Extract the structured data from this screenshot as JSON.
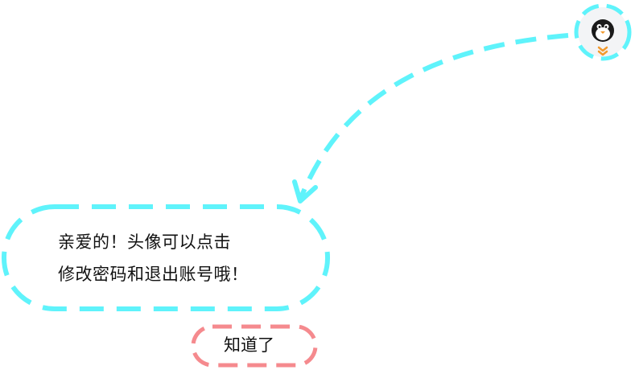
{
  "guide": {
    "message_line1": "亲爱的！头像可以点击",
    "message_line2": "修改密码和退出账号哦！",
    "confirm_label": "知道了"
  },
  "avatar": {
    "icon": "penguin-icon"
  },
  "colors": {
    "accent_dash": "#5ff3fb",
    "button_dash": "#f58a8e",
    "avatar_bg": "#f3f4f6",
    "chevron": "#f29a2e",
    "text": "#111111"
  }
}
